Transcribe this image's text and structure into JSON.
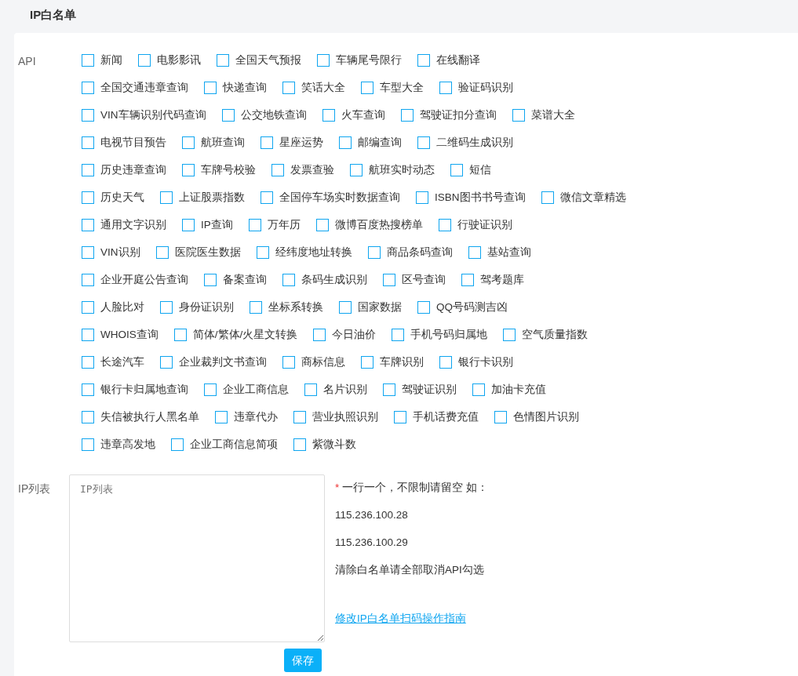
{
  "page_title": "IP白名单",
  "api_field": {
    "label": "API",
    "options": [
      {
        "label": "新闻",
        "checked": false
      },
      {
        "label": "电影影讯",
        "checked": false
      },
      {
        "label": "全国天气预报",
        "checked": false
      },
      {
        "label": "车辆尾号限行",
        "checked": false
      },
      {
        "label": "在线翻译",
        "checked": false
      },
      {
        "label": "全国交通违章查询",
        "checked": false
      },
      {
        "label": "快递查询",
        "checked": false
      },
      {
        "label": "笑话大全",
        "checked": false
      },
      {
        "label": "车型大全",
        "checked": false
      },
      {
        "label": "验证码识别",
        "checked": false
      },
      {
        "label": "VIN车辆识别代码查询",
        "checked": false
      },
      {
        "label": "公交地铁查询",
        "checked": false
      },
      {
        "label": "火车查询",
        "checked": false
      },
      {
        "label": "驾驶证扣分查询",
        "checked": false
      },
      {
        "label": "菜谱大全",
        "checked": false
      },
      {
        "label": "电视节目预告",
        "checked": false
      },
      {
        "label": "航班查询",
        "checked": false
      },
      {
        "label": "星座运势",
        "checked": false
      },
      {
        "label": "邮编查询",
        "checked": false
      },
      {
        "label": "二维码生成识别",
        "checked": false
      },
      {
        "label": "历史违章查询",
        "checked": false
      },
      {
        "label": "车牌号校验",
        "checked": false
      },
      {
        "label": "发票查验",
        "checked": false
      },
      {
        "label": "航班实时动态",
        "checked": false
      },
      {
        "label": "短信",
        "checked": false
      },
      {
        "label": "历史天气",
        "checked": false
      },
      {
        "label": "上证股票指数",
        "checked": false
      },
      {
        "label": "全国停车场实时数据查询",
        "checked": false
      },
      {
        "label": "ISBN图书书号查询",
        "checked": false
      },
      {
        "label": "微信文章精选",
        "checked": false
      },
      {
        "label": "通用文字识别",
        "checked": false
      },
      {
        "label": "IP查询",
        "checked": false
      },
      {
        "label": "万年历",
        "checked": false
      },
      {
        "label": "微博百度热搜榜单",
        "checked": false
      },
      {
        "label": "行驶证识别",
        "checked": false
      },
      {
        "label": "VIN识别",
        "checked": false
      },
      {
        "label": "医院医生数据",
        "checked": false
      },
      {
        "label": "经纬度地址转换",
        "checked": false
      },
      {
        "label": "商品条码查询",
        "checked": false
      },
      {
        "label": "基站查询",
        "checked": false
      },
      {
        "label": "企业开庭公告查询",
        "checked": false
      },
      {
        "label": "备案查询",
        "checked": false
      },
      {
        "label": "条码生成识别",
        "checked": false
      },
      {
        "label": "区号查询",
        "checked": false
      },
      {
        "label": "驾考题库",
        "checked": false
      },
      {
        "label": "人脸比对",
        "checked": false
      },
      {
        "label": "身份证识别",
        "checked": false
      },
      {
        "label": "坐标系转换",
        "checked": false
      },
      {
        "label": "国家数据",
        "checked": false
      },
      {
        "label": "QQ号码测吉凶",
        "checked": false
      },
      {
        "label": "WHOIS查询",
        "checked": false
      },
      {
        "label": "简体/繁体/火星文转换",
        "checked": false
      },
      {
        "label": "今日油价",
        "checked": false
      },
      {
        "label": "手机号码归属地",
        "checked": false
      },
      {
        "label": "空气质量指数",
        "checked": false
      },
      {
        "label": "长途汽车",
        "checked": false
      },
      {
        "label": "企业裁判文书查询",
        "checked": false
      },
      {
        "label": "商标信息",
        "checked": false
      },
      {
        "label": "车牌识别",
        "checked": false
      },
      {
        "label": "银行卡识别",
        "checked": false
      },
      {
        "label": "银行卡归属地查询",
        "checked": false
      },
      {
        "label": "企业工商信息",
        "checked": false
      },
      {
        "label": "名片识别",
        "checked": false
      },
      {
        "label": "驾驶证识别",
        "checked": false
      },
      {
        "label": "加油卡充值",
        "checked": false
      },
      {
        "label": "失信被执行人黑名单",
        "checked": false
      },
      {
        "label": "违章代办",
        "checked": false
      },
      {
        "label": "营业执照识别",
        "checked": false
      },
      {
        "label": "手机话费充值",
        "checked": false
      },
      {
        "label": "色情图片识别",
        "checked": false
      },
      {
        "label": "违章高发地",
        "checked": false
      },
      {
        "label": "企业工商信息简项",
        "checked": false
      },
      {
        "label": "紫微斗数",
        "checked": false
      }
    ]
  },
  "ip_field": {
    "label": "IP列表",
    "placeholder": "IP列表"
  },
  "notes": {
    "required_mark": "*",
    "hint": "一行一个，不限制请留空 如：",
    "examples": [
      "115.236.100.28",
      "115.236.100.29"
    ],
    "clear_hint": "清除白名单请全部取消API勾选",
    "guide_link": "修改IP白名单扫码操作指南"
  },
  "save_button": "保存"
}
